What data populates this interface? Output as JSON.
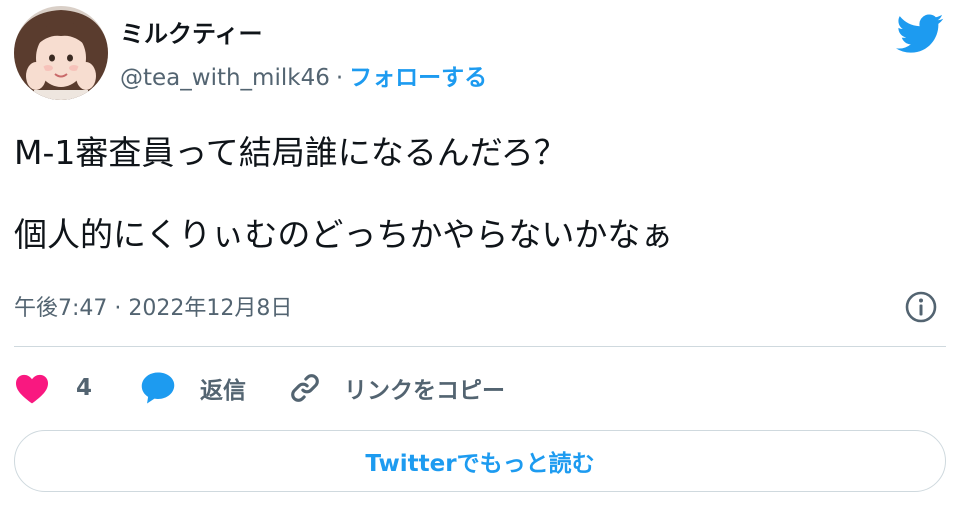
{
  "author": {
    "display_name": "ミルクティー",
    "handle": "@tea_with_milk46",
    "separator": "·",
    "follow_label": "フォローする"
  },
  "tweet": {
    "line1": "M-1審査員って結局誰になるんだろ？",
    "line2": "個人的にくりぃむのどっちかやらないかなぁ",
    "timestamp": "午後7:47 · 2022年12月8日"
  },
  "actions": {
    "like_count": "4",
    "reply_label": "返信",
    "copy_link_label": "リンクをコピー"
  },
  "read_more_label": "Twitterでもっと読む",
  "colors": {
    "accent": "#1d9bf0",
    "like": "#f91880",
    "text": "#0f1419",
    "muted": "#536471",
    "border": "#cfd9de"
  },
  "icons": {
    "brand": "twitter-bird-icon",
    "info": "info-icon",
    "like": "heart-icon",
    "reply": "speech-bubble-icon",
    "copy": "link-icon"
  }
}
